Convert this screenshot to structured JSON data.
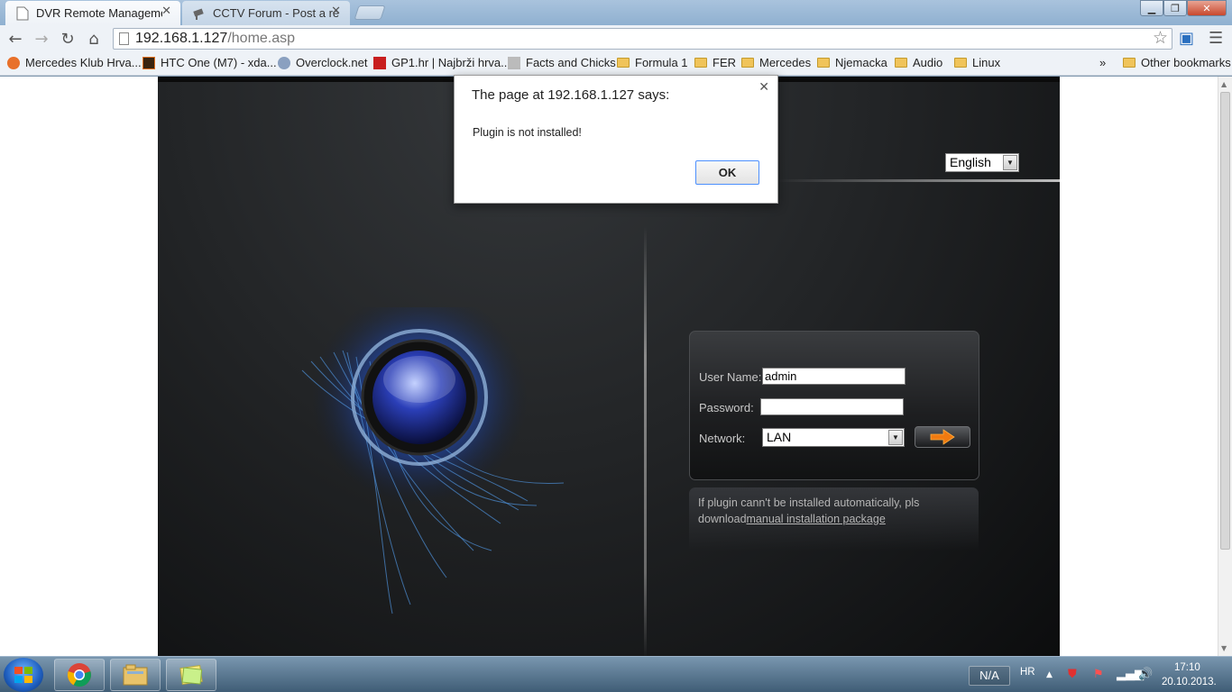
{
  "browser": {
    "tabs": [
      {
        "label": "DVR Remote Management",
        "active": true
      },
      {
        "label": "CCTV Forum - Post a reply",
        "active": false
      }
    ],
    "close_glyph": "✕",
    "url_host": "192.168.1.127",
    "url_path": "/home.asp",
    "bookmarks": [
      {
        "label": "Mercedes Klub Hrva...",
        "icon": "mercedes-favicon"
      },
      {
        "label": "HTC One (M7) - xda...",
        "icon": "xda-favicon"
      },
      {
        "label": "Overclock.net",
        "icon": "overclock-favicon"
      },
      {
        "label": "GP1.hr | Najbrži hrva...",
        "icon": "gp1-favicon"
      },
      {
        "label": "Facts and Chicks",
        "icon": "facts-favicon"
      },
      {
        "label": "Formula 1",
        "icon": "folder-icon"
      },
      {
        "label": "FER",
        "icon": "folder-icon"
      },
      {
        "label": "Mercedes",
        "icon": "folder-icon"
      },
      {
        "label": "Njemacka",
        "icon": "folder-icon"
      },
      {
        "label": "Audio",
        "icon": "folder-icon"
      },
      {
        "label": "Linux",
        "icon": "folder-icon"
      }
    ],
    "overflow_chevron": "»",
    "other_bookmarks": "Other bookmarks"
  },
  "dvr": {
    "language": "English",
    "login": {
      "username_label": "User Name:",
      "username_value": "admin",
      "password_label": "Password:",
      "network_label": "Network:",
      "network_value": "LAN"
    },
    "plugin_note_text": "If plugin cann't be installed automatically, pls download",
    "plugin_note_link": "manual installation package"
  },
  "alert": {
    "title": "The page at 192.168.1.127 says:",
    "message": "Plugin is not installed!",
    "ok_label": "OK"
  },
  "taskbar": {
    "tray_label": "N/A",
    "language": "HR",
    "time": "17:10",
    "date": "20.10.2013."
  },
  "colors": {
    "accent_blue": "#3a6fd8",
    "arrow_orange": "#f07a10",
    "dvr_background": "#1e2022"
  }
}
